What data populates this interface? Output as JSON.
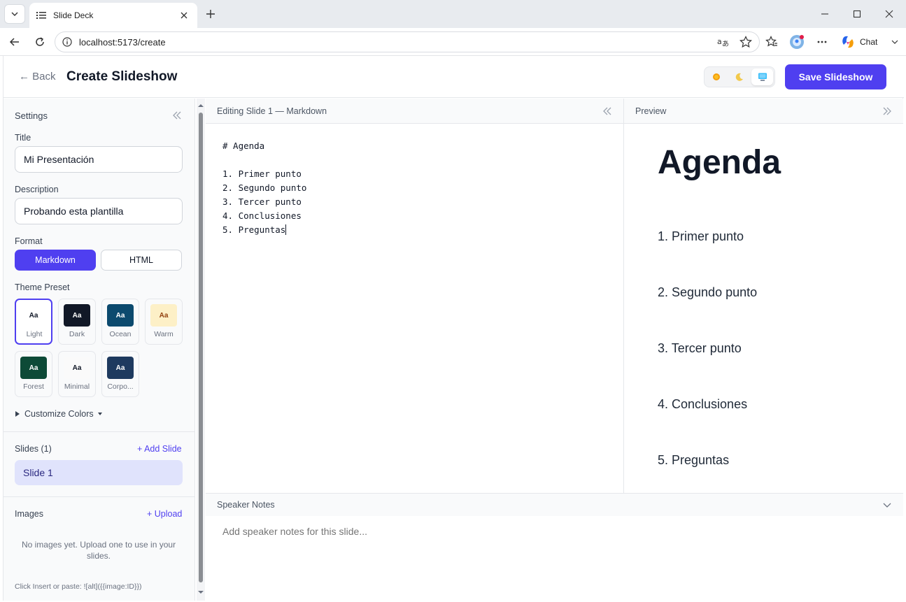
{
  "browser": {
    "tab_title": "Slide Deck",
    "url": "localhost:5173/create",
    "chat_label": "Chat"
  },
  "header": {
    "back_label": "← Back",
    "title": "Create Slideshow",
    "save_label": "Save Slideshow"
  },
  "sidebar": {
    "heading": "Settings",
    "title_label": "Title",
    "title_value": "Mi Presentación",
    "description_label": "Description",
    "description_value": "Probando esta plantilla",
    "format_label": "Format",
    "format_options": [
      "Markdown",
      "HTML"
    ],
    "theme_label": "Theme Preset",
    "themes": [
      {
        "name": "Light",
        "swatch": "Aa",
        "bg": "#ffffff",
        "fg": "#111827"
      },
      {
        "name": "Dark",
        "swatch": "Aa",
        "bg": "#111827",
        "fg": "#ffffff"
      },
      {
        "name": "Ocean",
        "swatch": "Aa",
        "bg": "#0c4a6e",
        "fg": "#ffffff"
      },
      {
        "name": "Warm",
        "swatch": "Aa",
        "bg": "#fdf0c7",
        "fg": "#92400e"
      },
      {
        "name": "Forest",
        "swatch": "Aa",
        "bg": "#0d4a37",
        "fg": "#ffffff"
      },
      {
        "name": "Minimal",
        "swatch": "Aa",
        "bg": "#fafafa",
        "fg": "#111827"
      },
      {
        "name": "Corpo...",
        "swatch": "Aa",
        "bg": "#1e3a5f",
        "fg": "#ffffff"
      }
    ],
    "customize_label": "Customize Colors",
    "slides_label": "Slides (1)",
    "add_slide_label": "+ Add Slide",
    "slides": [
      "Slide 1"
    ],
    "images_label": "Images",
    "upload_label": "+ Upload",
    "images_empty": "No images yet. Upload one to use in your slides.",
    "insert_hint": "Click Insert or paste: ![alt]({{image:ID}})"
  },
  "editor": {
    "header": "Editing Slide 1 — Markdown",
    "lines": [
      "# Agenda",
      "",
      "1. Primer punto",
      "2. Segundo punto",
      "3. Tercer punto",
      "4. Conclusiones",
      "5. Preguntas"
    ]
  },
  "preview": {
    "header": "Preview",
    "heading": "Agenda",
    "items": [
      "1. Primer punto",
      "2. Segundo punto",
      "3. Tercer punto",
      "4. Conclusiones",
      "5. Preguntas"
    ]
  },
  "notes": {
    "header": "Speaker Notes",
    "placeholder": "Add speaker notes for this slide..."
  },
  "colors": {
    "accent": "#4f3ff0",
    "selected_slide_bg": "#e0e3fc"
  }
}
